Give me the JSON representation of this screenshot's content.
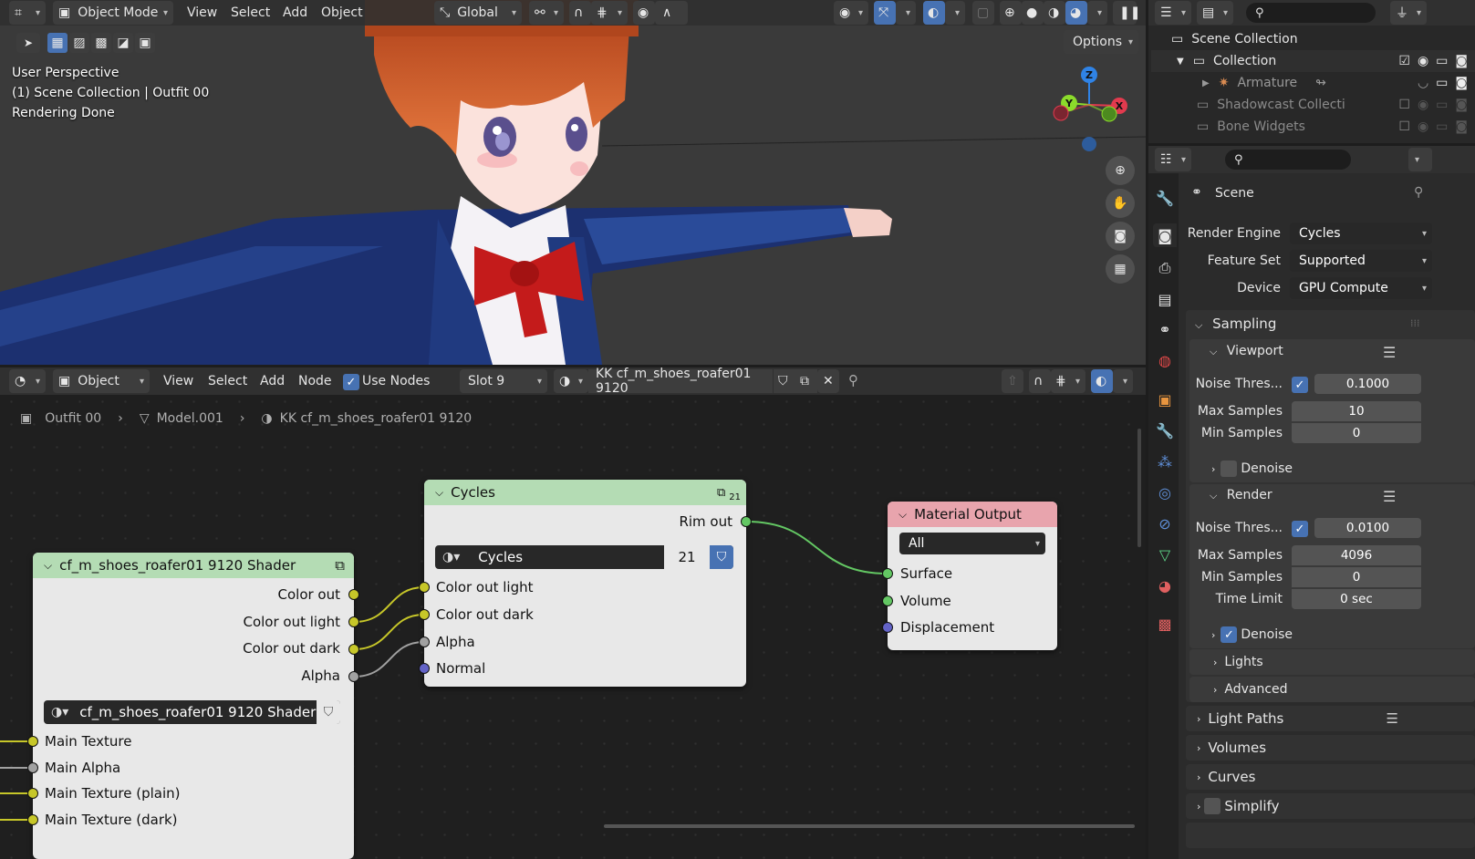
{
  "viewport": {
    "mode": "Object Mode",
    "menus": [
      "View",
      "Select",
      "Add",
      "Object"
    ],
    "transform_orientation": "Global",
    "options": "Options",
    "overlay_lines": [
      "User Perspective",
      "(1) Scene Collection | Outfit 00",
      "Rendering Done"
    ],
    "gizmo_axes": [
      "Z",
      "Y",
      "X"
    ]
  },
  "node_editor": {
    "object_mode": "Object",
    "menus": [
      "View",
      "Select",
      "Add",
      "Node"
    ],
    "use_nodes_label": "Use Nodes",
    "slot": "Slot 9",
    "material_name": "KK cf_m_shoes_roafer01 9120",
    "breadcrumb": [
      "Outfit 00",
      "Model.001",
      "KK cf_m_shoes_roafer01 9120"
    ]
  },
  "nodes": {
    "shader": {
      "title": "cf_m_shoes_roafer01 9120 Shader",
      "outputs": [
        "Color out",
        "Color out light",
        "Color out dark",
        "Alpha"
      ],
      "group_name": "cf_m_shoes_roafer01 9120 Shader",
      "inputs": [
        "Main Texture",
        "Main Alpha",
        "Main Texture (plain)",
        "Main Texture (dark)"
      ]
    },
    "cycles": {
      "title": "Cycles",
      "users_badge": "21",
      "output": "Rim out",
      "group_name": "Cycles",
      "group_users": "21",
      "inputs": [
        "Color out light",
        "Color out dark",
        "Alpha",
        "Normal"
      ]
    },
    "material_output": {
      "title": "Material Output",
      "target": "All",
      "inputs": [
        "Surface",
        "Volume",
        "Displacement"
      ]
    }
  },
  "outliner": {
    "rows": [
      {
        "label": "Scene Collection"
      },
      {
        "label": "Collection"
      },
      {
        "label": "Armature"
      },
      {
        "label": "Shadowcast Collection"
      },
      {
        "label": "Bone Widgets"
      }
    ]
  },
  "properties": {
    "context": "Scene",
    "render_engine_label": "Render Engine",
    "render_engine": "Cycles",
    "feature_set_label": "Feature Set",
    "feature_set": "Supported",
    "device_label": "Device",
    "device": "GPU Compute",
    "sampling": "Sampling",
    "viewport": {
      "title": "Viewport",
      "noise_label": "Noise Thres...",
      "noise": "0.1000",
      "max_label": "Max Samples",
      "max": "10",
      "min_label": "Min Samples",
      "min": "0",
      "denoise": "Denoise"
    },
    "render": {
      "title": "Render",
      "noise_label": "Noise Thres...",
      "noise": "0.0100",
      "max_label": "Max Samples",
      "max": "4096",
      "min_label": "Min Samples",
      "min": "0",
      "time_label": "Time Limit",
      "time": "0 sec",
      "denoise": "Denoise"
    },
    "subpanels": [
      "Lights",
      "Advanced"
    ],
    "panels": [
      "Light Paths",
      "Volumes",
      "Curves",
      "Simplify"
    ]
  },
  "colors": {
    "accent": "#4772b3",
    "header": "#303030",
    "node_bg": "#e8e8e8",
    "shader_header": "#b4dcb4",
    "output_header": "#e8a4ad"
  }
}
